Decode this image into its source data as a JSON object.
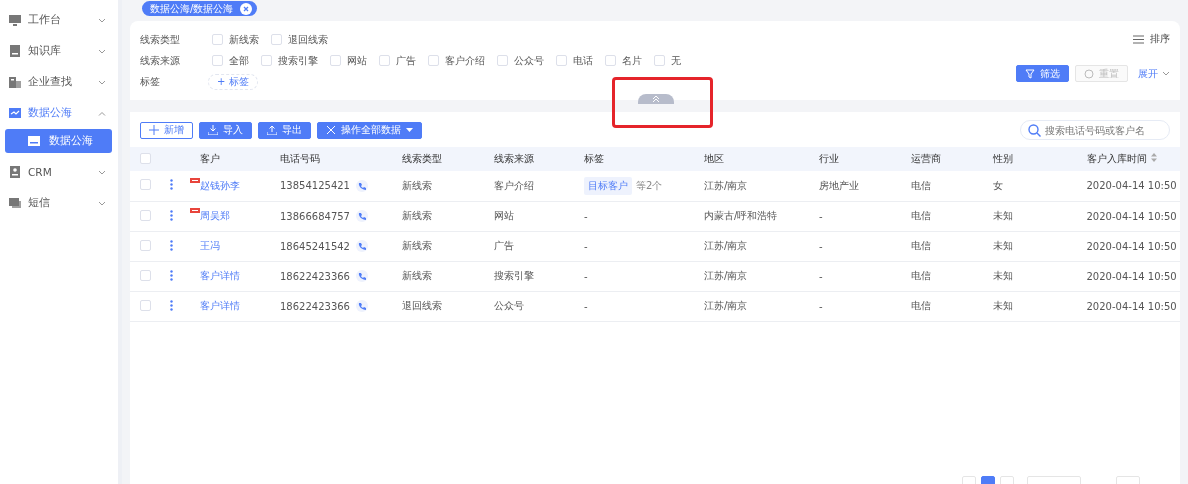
{
  "sidebar": {
    "items": [
      {
        "label": "工作台",
        "active": false,
        "expanded": false
      },
      {
        "label": "知识库",
        "active": false,
        "expanded": false
      },
      {
        "label": "企业查找",
        "active": false,
        "expanded": false
      },
      {
        "label": "数据公海",
        "active": true,
        "expanded": true,
        "children": [
          {
            "label": "数据公海",
            "selected": true
          }
        ]
      },
      {
        "label": "CRM",
        "active": false,
        "expanded": false
      },
      {
        "label": "短信",
        "active": false,
        "expanded": false
      }
    ]
  },
  "breadcrumb": {
    "label": "数据公海/数据公海"
  },
  "filters": {
    "rows": [
      {
        "label": "线索类型",
        "kind": "checkboxes",
        "options": [
          {
            "label": "新线索",
            "checked": false
          },
          {
            "label": "退回线索",
            "checked": false
          }
        ]
      },
      {
        "label": "线索来源",
        "kind": "checkboxes",
        "options": [
          {
            "label": "全部",
            "checked": false
          },
          {
            "label": "搜索引擎",
            "checked": false
          },
          {
            "label": "网站",
            "checked": false
          },
          {
            "label": "广告",
            "checked": false
          },
          {
            "label": "客户介绍",
            "checked": false
          },
          {
            "label": "公众号",
            "checked": false
          },
          {
            "label": "电话",
            "checked": false
          },
          {
            "label": "名片",
            "checked": false
          },
          {
            "label": "无",
            "checked": false
          }
        ]
      },
      {
        "label": "标签",
        "kind": "add-button",
        "button": "+ 标签"
      }
    ],
    "sort": "排序",
    "filter_button": "筛选",
    "reset_button": {
      "label": "重置",
      "disabled": true
    },
    "expand_link": "展开",
    "collapsed": false
  },
  "toolbar": {
    "buttons": [
      {
        "label": "新增",
        "kind": "outline"
      },
      {
        "label": "导入",
        "kind": "solid"
      },
      {
        "label": "导出",
        "kind": "solid"
      },
      {
        "label": "操作全部数据",
        "kind": "dropdown"
      }
    ],
    "search": {
      "placeholder": "搜索电话号码或客户名"
    }
  },
  "table": {
    "all_checked": false,
    "columns": [
      {
        "label": "客户",
        "sortable": false
      },
      {
        "label": "电话号码",
        "sortable": false
      },
      {
        "label": "线索类型",
        "sortable": false
      },
      {
        "label": "线索来源",
        "sortable": false
      },
      {
        "label": "标签",
        "sortable": false
      },
      {
        "label": "地区",
        "sortable": false
      },
      {
        "label": "行业",
        "sortable": false
      },
      {
        "label": "运营商",
        "sortable": false
      },
      {
        "label": "性别",
        "sortable": false
      },
      {
        "label": "客户入库时间",
        "sortable": true
      }
    ],
    "rows": [
      {
        "checked": false,
        "new": true,
        "customer": "赵钱孙李",
        "phone": "13854125421",
        "type": "新线索",
        "source": "客户介绍",
        "tags": [
          "目标客户"
        ],
        "tag_note": "等2个",
        "region": "江苏/南京",
        "industry": "房地产业",
        "operator": "电信",
        "gender": "女",
        "time": "2020-04-14  10:50"
      },
      {
        "checked": false,
        "new": true,
        "customer": "周吴郑",
        "phone": "13866684757",
        "type": "新线索",
        "source": "网站",
        "tag_text": "-",
        "region": "内蒙古/呼和浩特",
        "industry": "-",
        "operator": "电信",
        "gender": "未知",
        "time": "2020-04-14  10:50"
      },
      {
        "checked": false,
        "new": false,
        "customer": "王冯",
        "phone": "18645241542",
        "type": "新线索",
        "source": "广告",
        "tag_text": "-",
        "region": "江苏/南京",
        "industry": "-",
        "operator": "电信",
        "gender": "未知",
        "time": "2020-04-14  10:50"
      },
      {
        "checked": false,
        "new": false,
        "customer": "客户详情",
        "phone": "18622423366",
        "type": "新线索",
        "source": "搜索引擎",
        "tag_text": "-",
        "region": "江苏/南京",
        "industry": "-",
        "operator": "电信",
        "gender": "未知",
        "time": "2020-04-14  10:50"
      },
      {
        "checked": false,
        "new": false,
        "customer": "客户详情",
        "phone": "18622423366",
        "type": "退回线索",
        "source": "公众号",
        "tag_text": "-",
        "region": "江苏/南京",
        "industry": "-",
        "operator": "电信",
        "gender": "未知",
        "time": "2020-04-14  10:50"
      }
    ]
  },
  "pagination": {
    "pages": [
      {
        "selected": true
      }
    ]
  }
}
